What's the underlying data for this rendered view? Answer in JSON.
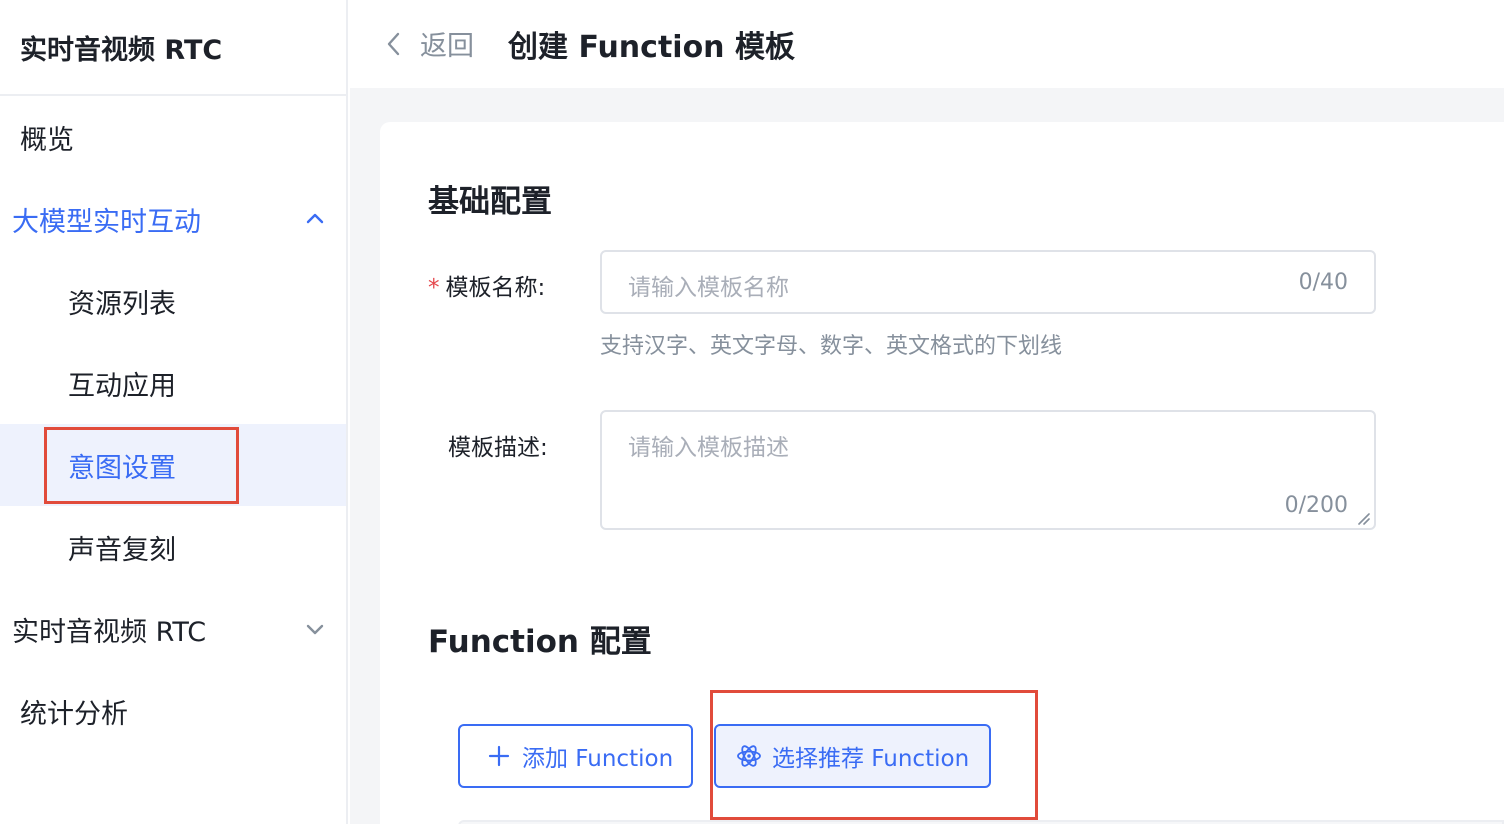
{
  "sidebar": {
    "title": "实时音视频 RTC",
    "items": [
      {
        "label": "概览"
      },
      {
        "label": "大模型实时互动"
      },
      {
        "label": "资源列表"
      },
      {
        "label": "互动应用"
      },
      {
        "label": "意图设置"
      },
      {
        "label": "声音复刻"
      },
      {
        "label": "实时音视频 RTC"
      },
      {
        "label": "统计分析"
      }
    ]
  },
  "header": {
    "back_label": "返回",
    "title": "创建 Function 模板"
  },
  "basic": {
    "section_title": "基础配置",
    "name_label": "模板名称:",
    "name_required": "*",
    "name_placeholder": "请输入模板名称",
    "name_count": "0/40",
    "name_hint": "支持汉字、英文字母、数字、英文格式的下划线",
    "desc_label": "模板描述:",
    "desc_placeholder": "请输入模板描述",
    "desc_count": "0/200"
  },
  "function": {
    "section_title": "Function 配置",
    "add_button": "添加 Function",
    "recommend_button": "选择推荐 Function"
  },
  "colors": {
    "accent": "#3a6cf4",
    "highlight": "#e14b3b",
    "active_bg": "#eef2fd"
  }
}
